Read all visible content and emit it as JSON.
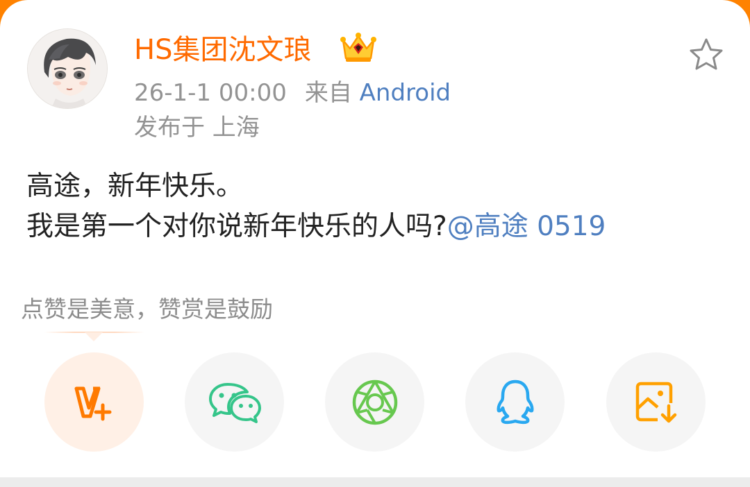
{
  "post": {
    "username": "HS集团沈文琅",
    "timestamp": "26-1-1 00:00",
    "source_prefix": "来自",
    "source": "Android",
    "location": "发布于 上海",
    "text_line1": "高途，新年快乐。",
    "text_line2": "我是第一个对你说新年快乐的人吗?",
    "mention": "@高途 0519"
  },
  "reward": {
    "hint": "点赞是美意，赞赏是鼓励"
  },
  "share_options": [
    {
      "name": "vplus",
      "icon": "v-plus-icon",
      "color": "#ff7a00"
    },
    {
      "name": "wechat",
      "icon": "wechat-icon",
      "color": "#35c58a"
    },
    {
      "name": "moments",
      "icon": "moments-aperture-icon",
      "color": "#67c84f"
    },
    {
      "name": "qq",
      "icon": "qq-penguin-icon",
      "color": "#29a8f0"
    },
    {
      "name": "save-image",
      "icon": "save-image-icon",
      "color": "#ffa000"
    }
  ],
  "colors": {
    "brand_orange": "#ff8200",
    "username": "#ff6a00",
    "link": "#4f7fc0"
  }
}
